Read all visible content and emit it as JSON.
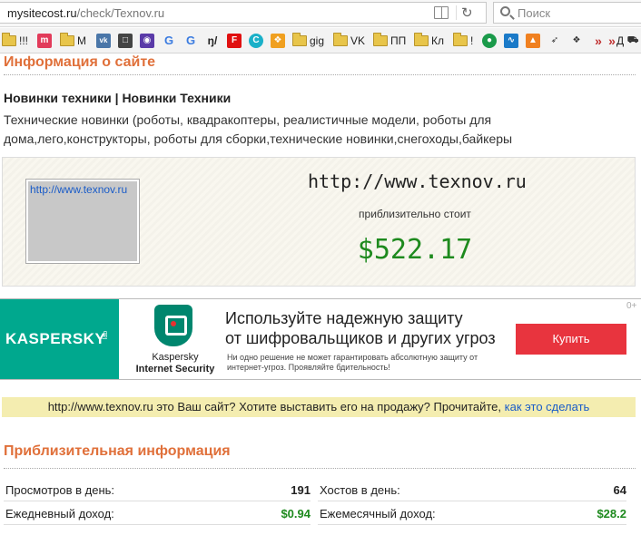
{
  "browser": {
    "url_domain": "mysitecost.ru",
    "url_path": "/check/Texnov.ru",
    "search_placeholder": "Поиск",
    "reload_icon": "reload-icon",
    "reader_icon": "reader-view-icon"
  },
  "bookmarks": [
    {
      "label": "!!!",
      "type": "folder"
    },
    {
      "label": "",
      "type": "favicon",
      "icon": "m-red-icon",
      "color": "#e23b5a",
      "glyph": "m"
    },
    {
      "label": "М",
      "type": "folder"
    },
    {
      "label": "",
      "type": "favicon",
      "icon": "vk-icon",
      "color": "#4a76a8",
      "glyph": "vk"
    },
    {
      "label": "",
      "type": "favicon",
      "icon": "ok-icon",
      "color": "#333",
      "glyph": "□"
    },
    {
      "label": "",
      "type": "favicon",
      "icon": "camera-icon",
      "color": "#5a3aa8",
      "glyph": "◉"
    },
    {
      "label": "",
      "type": "favicon",
      "icon": "google-icon",
      "color": "#ffffff",
      "glyph": "G"
    },
    {
      "label": "",
      "type": "favicon",
      "icon": "google-icon-2",
      "color": "#ffffff",
      "glyph": "G"
    },
    {
      "label": "",
      "type": "favicon",
      "icon": "np-icon",
      "color": "#ffffff",
      "glyph": "ŋ̸"
    },
    {
      "label": "",
      "type": "favicon",
      "icon": "flipboard-icon",
      "color": "#e01010",
      "glyph": "F"
    },
    {
      "label": "",
      "type": "favicon",
      "icon": "c-teal-icon",
      "color": "#1ab0c8",
      "glyph": "C"
    },
    {
      "label": "",
      "type": "favicon",
      "icon": "orange-grid-icon",
      "color": "#f0a020",
      "glyph": "❖"
    },
    {
      "label": "gig",
      "type": "folder"
    },
    {
      "label": "VK",
      "type": "folder"
    },
    {
      "label": "ПП",
      "type": "folder"
    },
    {
      "label": "Кл",
      "type": "folder"
    },
    {
      "label": "!",
      "type": "folder"
    },
    {
      "label": "",
      "type": "favicon",
      "icon": "chat-green-icon",
      "color": "#1a9a4a",
      "glyph": "●"
    },
    {
      "label": "",
      "type": "favicon",
      "icon": "pulse-icon",
      "color": "#1a7ac8",
      "glyph": "∿"
    },
    {
      "label": "",
      "type": "favicon",
      "icon": "bolt-icon",
      "color": "#f08020",
      "glyph": "▲"
    },
    {
      "label": "",
      "type": "favicon",
      "icon": "rocket-icon",
      "color": "#ffffff",
      "glyph": "➶"
    },
    {
      "label": "",
      "type": "favicon",
      "icon": "tag-icon",
      "color": "#ffffff",
      "glyph": "❖"
    },
    {
      "label": "",
      "type": "favicon",
      "icon": "double-arrow-icon",
      "color": "#ffffff",
      "glyph": "»"
    },
    {
      "label": "Д",
      "type": "favicon",
      "icon": "double-arrow-icon-2",
      "color": "#ffffff",
      "glyph": "»"
    },
    {
      "label": "",
      "type": "favicon",
      "icon": "cart-icon",
      "color": "#ffffff",
      "glyph": "🛒"
    }
  ],
  "info": {
    "section_title": "Информация о сайте",
    "site_title": "Новинки техники | Новинки Техники",
    "site_description": "Технические новинки (роботы, квадракоптеры, реалистичные модели, роботы для дома,лего,конструкторы, роботы для сборки,технические новинки,снегоходы,байкеры",
    "thumbnail_link": "http://www.texnov.ru",
    "site_url": "http://www.texnov.ru",
    "cost_caption": "приблизительно стоит",
    "cost_value": "$522.17"
  },
  "ad": {
    "brand": "KASPERSKY",
    "brand_suffix": "lab",
    "product_line1": "Kaspersky",
    "product_line2": "Internet Security",
    "headline_1": "Используйте надежную защиту",
    "headline_2": "от шифровальщиков и других угроз",
    "subtext": "Ни одно решение не может гарантировать абсолютную защиту от интернет-угроз. Проявляйте бдительность!",
    "button_label": "Купить",
    "corner_badge": "0+"
  },
  "notice": {
    "text": "http://www.texnov.ru это Ваш сайт? Хотите выставить его на продажу? Прочитайте,",
    "link_text": "как это сделать"
  },
  "approx": {
    "section_title": "Приблизительная информация",
    "rows": [
      {
        "left_label": "Просмотров в день:",
        "left_value": "191",
        "right_label": "Хостов в день:",
        "right_value": "64"
      },
      {
        "left_label": "Ежедневный доход:",
        "left_value": "$0.94",
        "right_label": "Ежемесячный доход:",
        "right_value": "$28.2"
      }
    ]
  }
}
